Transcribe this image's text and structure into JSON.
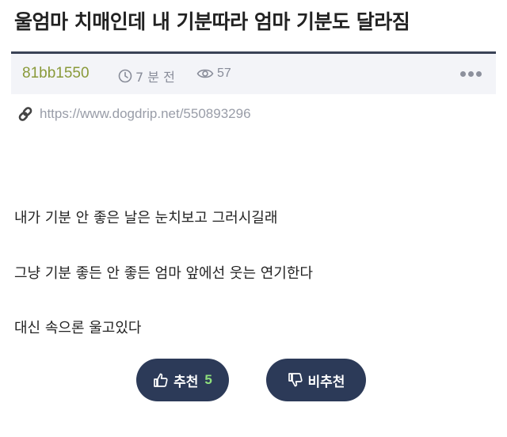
{
  "post": {
    "title": "울엄마 치매인데 내 기분따라 엄마 기분도 달라짐",
    "author": "81bb1550",
    "time": "7 분 전",
    "views": "57",
    "link": "https://www.dogdrip.net/550893296",
    "paragraphs": [
      "내가 기분 안 좋은 날은 눈치보고 그러시길래",
      "그냥 기분 좋든 안 좋든 엄마 앞에선 웃는 연기한다",
      "대신 속으론 울고있다"
    ]
  },
  "vote": {
    "upvote_label": "추천",
    "upvote_count": "5",
    "downvote_label": "비추천"
  },
  "icons": {
    "clock": "clock-icon",
    "eye": "eye-icon",
    "link": "link-icon",
    "more": "more-icon",
    "thumbs_up": "thumbs-up-icon",
    "thumbs_down": "thumbs-down-icon"
  },
  "colors": {
    "author": "#8a9a3a",
    "meta_bg": "#f3f4f8",
    "meta_border": "#3a4256",
    "button_bg": "#2c3a58",
    "upvote_count": "#8fe07c"
  }
}
